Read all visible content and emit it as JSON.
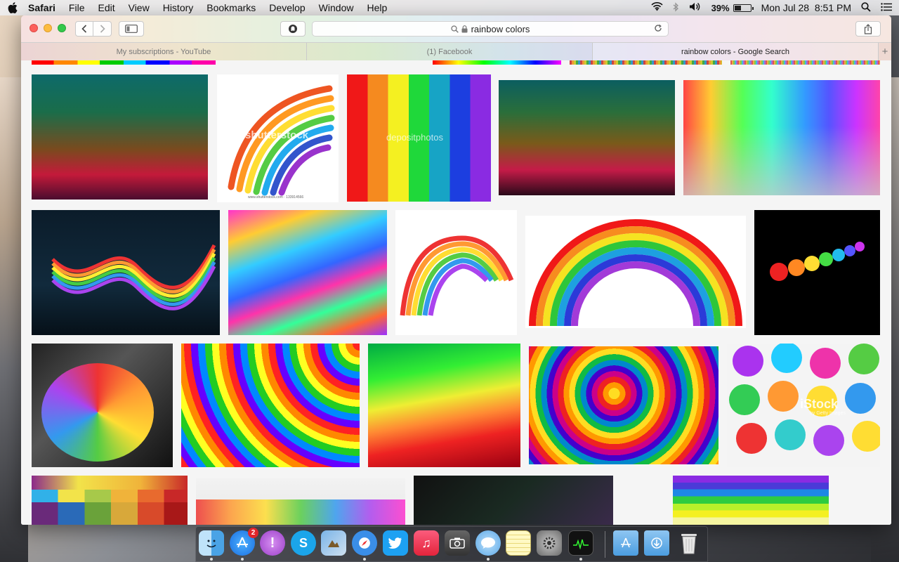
{
  "menubar": {
    "app_name": "Safari",
    "items": [
      "File",
      "Edit",
      "View",
      "History",
      "Bookmarks",
      "Develop",
      "Window",
      "Help"
    ],
    "battery_percent": "39%",
    "battery_level": 0.39,
    "datetime": "Mon Jul 28  8:51 PM"
  },
  "browser": {
    "address": "rainbow colors",
    "tabs": [
      {
        "label": "My subscriptions - YouTube"
      },
      {
        "label": "(1) Facebook"
      },
      {
        "label": "rainbow colors - Google Search"
      }
    ]
  },
  "results": {
    "watermarks": [
      "shutterstock",
      "www.shutterstock.com · 133914566",
      "depositphotos",
      "iStock",
      "by Getty Images"
    ]
  },
  "dock": {
    "app_store_badge": "2"
  },
  "colors": {
    "accent_blue": "#1b7cf2",
    "close": "#fc605c",
    "minimize": "#fdbc40",
    "zoom": "#34c84a"
  }
}
